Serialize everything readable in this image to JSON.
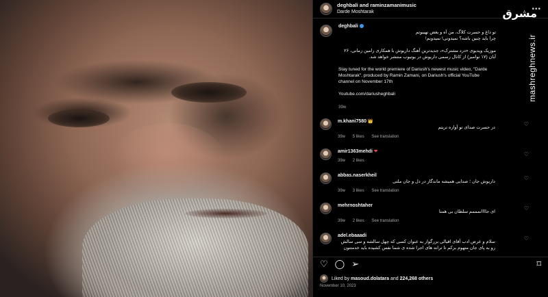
{
  "header": {
    "title": "deghbali and raminzamanimusic",
    "subtitle": "Darde Moshtarak",
    "more_icon": "more-horizontal-icon"
  },
  "caption": {
    "username": "deghbali",
    "line1": "تو داغ و حسرت کلاگ، من آه و بغض نهیبوتم",
    "line2": "چرا باید چنین باشه؟ نمیدونی! نمیدونم!",
    "fa_para": "موزیک ویدیوی «درد مشترک»، جدیدترین آهنگ داریوش با همکاری رامین زمانی، ۲۶ آبان (۱۷ نوامبر) از کانال رسمی داریوش در یوتیوب منتشر خواهد شد.",
    "en_para": "Stay tuned for the world premiere of Dariush's newest music video, \"Darde Moshtarak\", produced by Ramin Zamani, on Dariush's official YouTube channel on November 17th",
    "link": "Youtube.com/dariusheghbali",
    "time": "39w"
  },
  "comments": [
    {
      "user": "m.khani7580",
      "emoji": "👑",
      "text": "در حسرت صدای تو آواره تریتم",
      "time": "39w",
      "likes": "5 likes",
      "reply": "See translation"
    },
    {
      "user": "amir1363mehdi",
      "emoji": "❤",
      "text": "",
      "time": "39w",
      "likes": "2 likes",
      "reply": ""
    },
    {
      "user": "abbas.naserkheil",
      "emoji": "",
      "text": "داریوش جان ؛ صدایی همیشه ماندگار در دل و جان ملتی",
      "time": "39w",
      "likes": "3 likes",
      "reply": "See translation"
    },
    {
      "user": "mehrnoshtaher",
      "emoji": "",
      "text": "ای جاااانمممم سلطان بی همتا",
      "time": "39w",
      "likes": "2 likes",
      "reply": "See translation"
    },
    {
      "user": "adel.ebaaadi",
      "emoji": "",
      "text": "سلام و عرض ادب آقای اقبالی بزرگوار به عنوان کسی که چهل سالشه و سی سالش رو به پای جان متهوم بزکم تا ترانه های اجرا شده ی شما نفس کشیده باید خدمتتون عرض کنم که آرزو میکنم توی همکاریهاتون کمی تجدید نظر کنید راستش ما از شما ترانه هایی به یاد داریم که حکایت گر سهم ما از زندگی بود ، ترانه هایی که امید میدادند و چراغ راه ما بودند ، از شما خواهش میکنم که در انتخاب ترانه ها و همکاری های بعدیتون دقت بیشتری بکنید تا همون داریوش همیشگی بمونید",
      "time": "",
      "likes": "",
      "reply": ""
    }
  ],
  "actions": {
    "like_icon": "heart-icon",
    "comment_icon": "comment-icon",
    "share_icon": "share-icon",
    "save_icon": "bookmark-icon"
  },
  "likes": {
    "prefix": "Liked by",
    "user": "masoud.dolatara",
    "and": "and",
    "others": "224,268 others"
  },
  "date": "November 10, 2023",
  "watermark": {
    "logo": "مشرق",
    "text": "mashreghnews.ir"
  }
}
